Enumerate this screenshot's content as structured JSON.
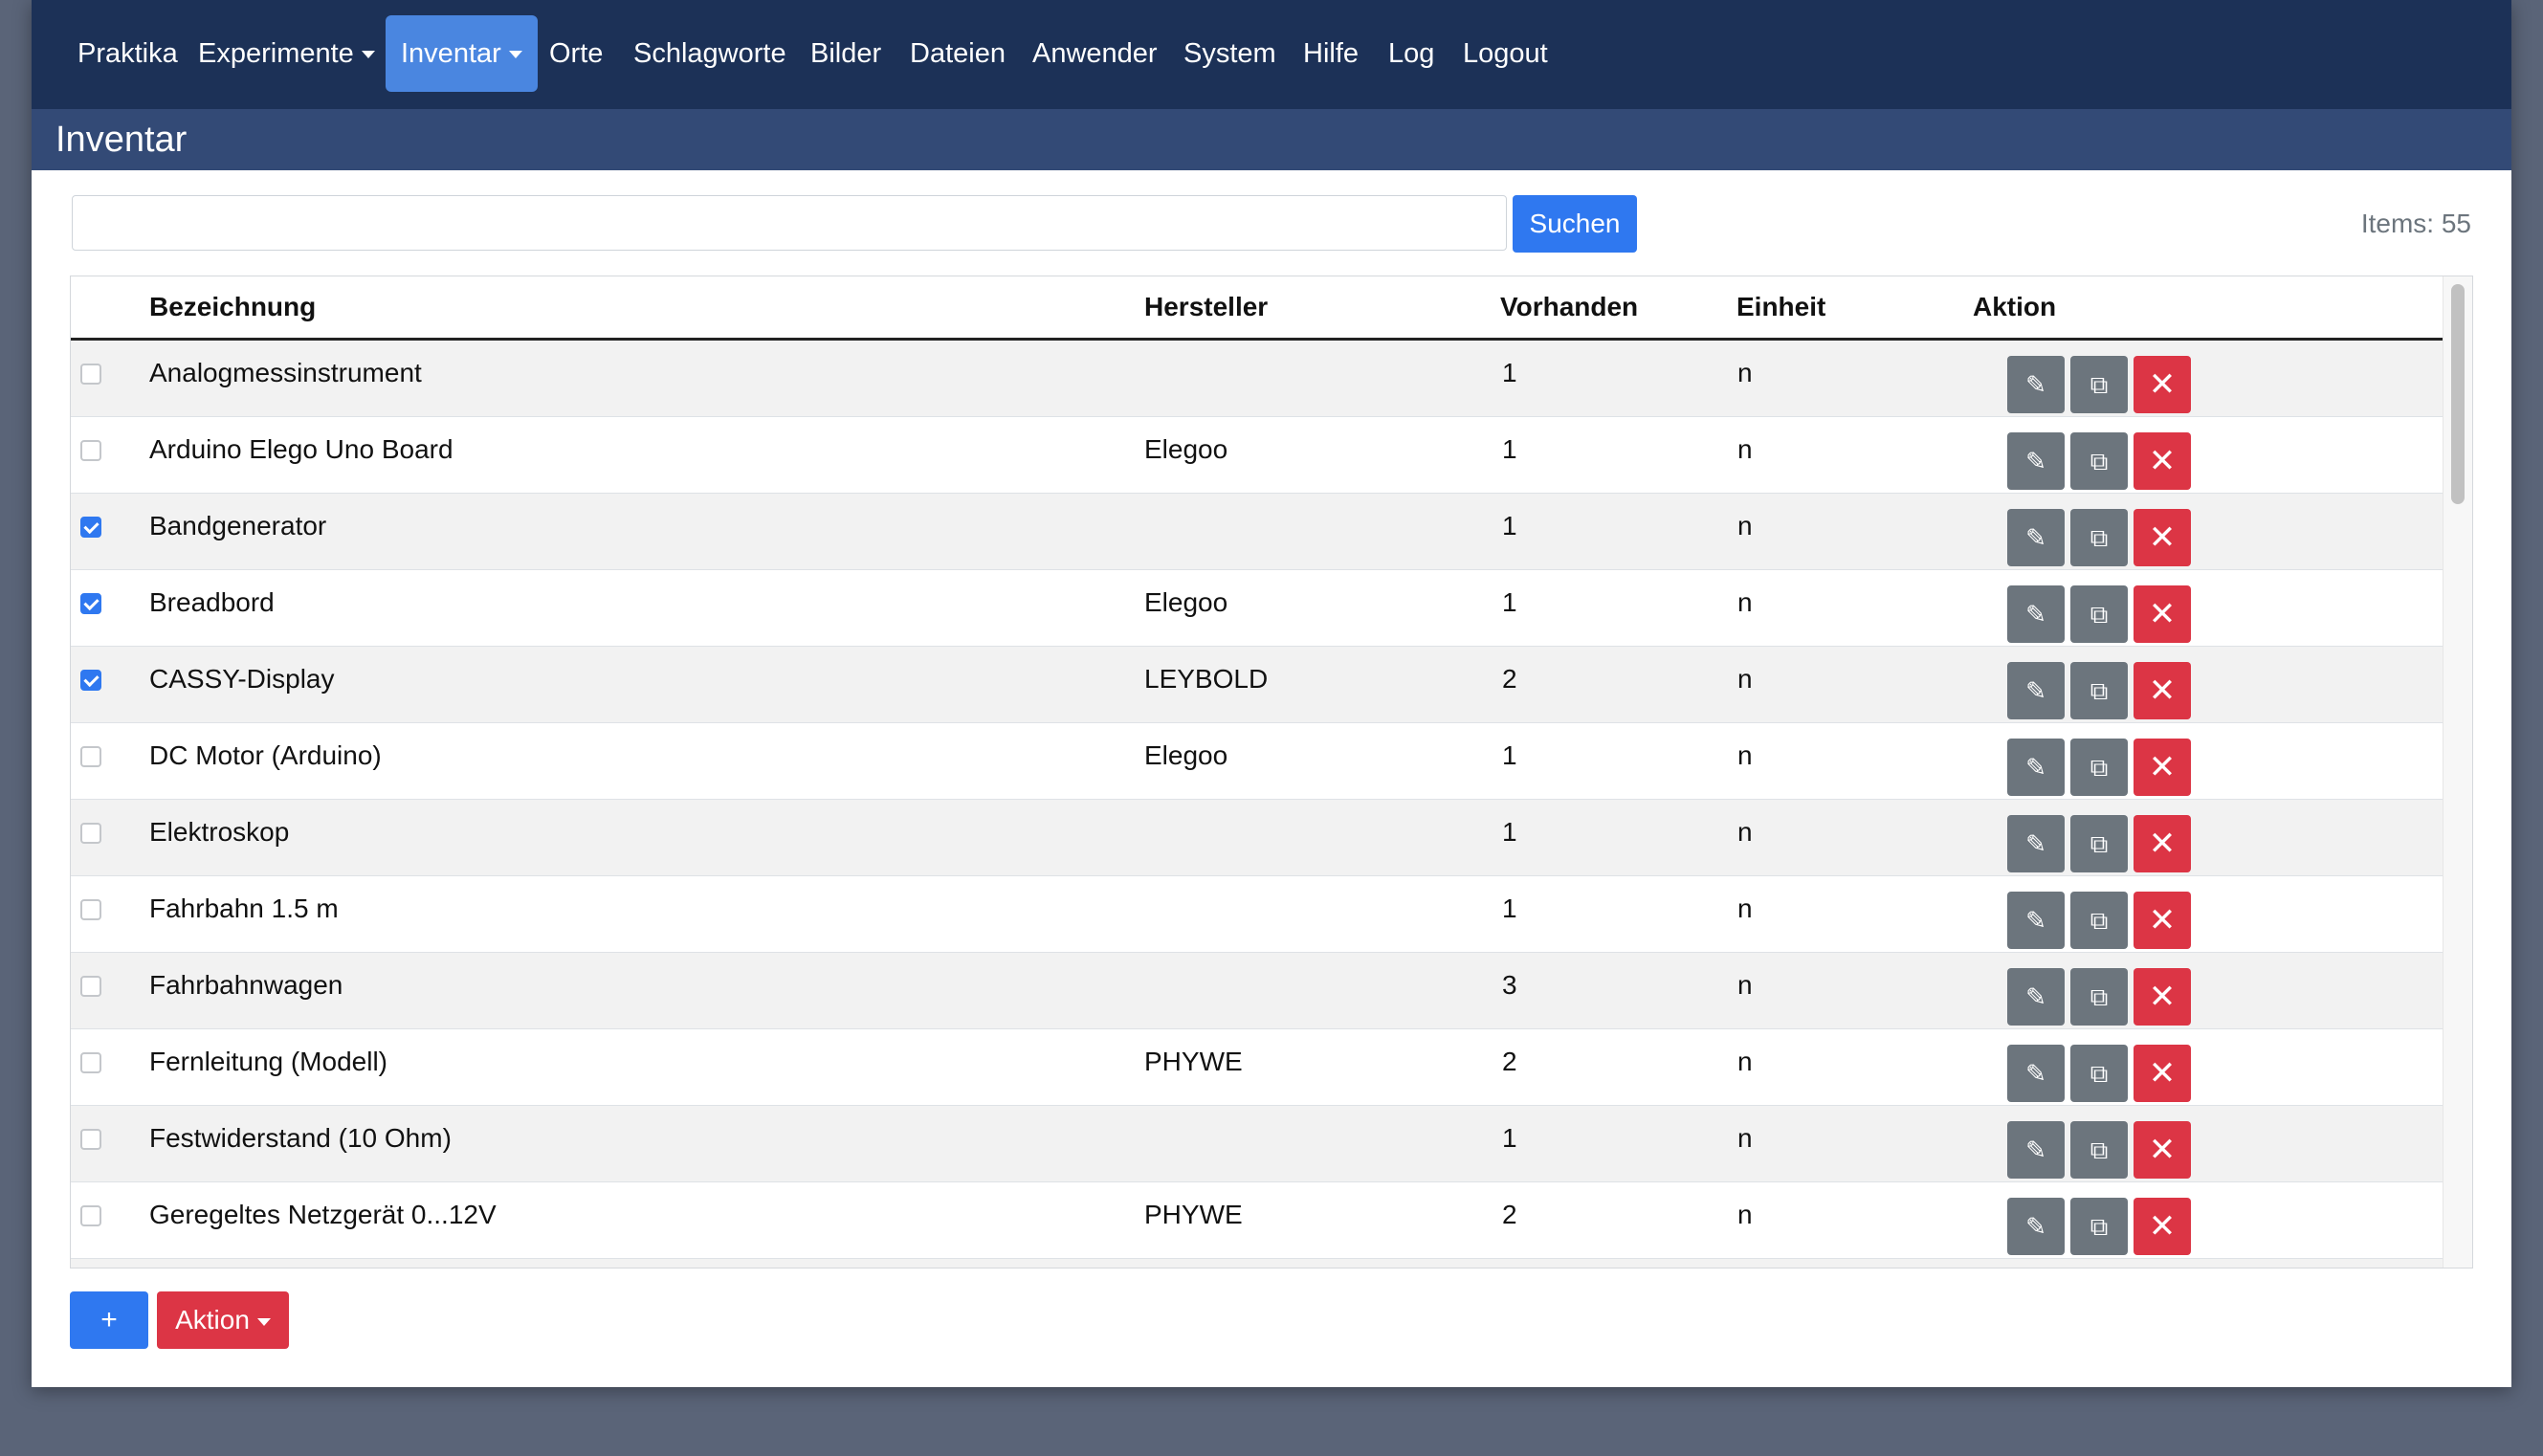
{
  "nav": {
    "items": [
      {
        "label": "Praktika",
        "dropdown": false,
        "active": false
      },
      {
        "label": "Experimente",
        "dropdown": true,
        "active": false
      },
      {
        "label": "Inventar",
        "dropdown": true,
        "active": true
      },
      {
        "label": "Orte",
        "dropdown": false,
        "active": false
      },
      {
        "label": "Schlagworte",
        "dropdown": false,
        "active": false
      },
      {
        "label": "Bilder",
        "dropdown": false,
        "active": false
      },
      {
        "label": "Dateien",
        "dropdown": false,
        "active": false
      },
      {
        "label": "Anwender",
        "dropdown": false,
        "active": false
      },
      {
        "label": "System",
        "dropdown": false,
        "active": false
      },
      {
        "label": "Hilfe",
        "dropdown": false,
        "active": false
      },
      {
        "label": "Log",
        "dropdown": false,
        "active": false
      },
      {
        "label": "Logout",
        "dropdown": false,
        "active": false
      }
    ]
  },
  "page": {
    "title": "Inventar"
  },
  "search": {
    "value": "",
    "placeholder": "",
    "button_label": "Suchen"
  },
  "items_count": "Items: 55",
  "table": {
    "headers": {
      "bezeichnung": "Bezeichnung",
      "hersteller": "Hersteller",
      "vorhanden": "Vorhanden",
      "einheit": "Einheit",
      "aktion": "Aktion"
    },
    "rows": [
      {
        "checked": false,
        "name": "Analogmessinstrument",
        "maker": "",
        "qty": "1",
        "unit": "n"
      },
      {
        "checked": false,
        "name": "Arduino Elego Uno Board",
        "maker": "Elegoo",
        "qty": "1",
        "unit": "n"
      },
      {
        "checked": true,
        "name": "Bandgenerator",
        "maker": "",
        "qty": "1",
        "unit": "n"
      },
      {
        "checked": true,
        "name": "Breadbord",
        "maker": "Elegoo",
        "qty": "1",
        "unit": "n"
      },
      {
        "checked": true,
        "name": "CASSY-Display",
        "maker": "LEYBOLD",
        "qty": "2",
        "unit": "n"
      },
      {
        "checked": false,
        "name": "DC Motor (Arduino)",
        "maker": "Elegoo",
        "qty": "1",
        "unit": "n"
      },
      {
        "checked": false,
        "name": "Elektroskop",
        "maker": "",
        "qty": "1",
        "unit": "n"
      },
      {
        "checked": false,
        "name": "Fahrbahn 1.5 m",
        "maker": "",
        "qty": "1",
        "unit": "n"
      },
      {
        "checked": false,
        "name": "Fahrbahnwagen",
        "maker": "",
        "qty": "3",
        "unit": "n"
      },
      {
        "checked": false,
        "name": "Fernleitung (Modell)",
        "maker": "PHYWE",
        "qty": "2",
        "unit": "n"
      },
      {
        "checked": false,
        "name": "Festwiderstand (10 Ohm)",
        "maker": "",
        "qty": "1",
        "unit": "n"
      },
      {
        "checked": false,
        "name": "Geregeltes Netzgerät 0...12V",
        "maker": "PHYWE",
        "qty": "2",
        "unit": "n"
      }
    ]
  },
  "icons": {
    "edit": "pencil-icon",
    "copy": "copy-icon",
    "delete": "close-icon"
  },
  "colors": {
    "navbar": "#1c3157",
    "titlebar": "#334a76",
    "primary": "#2f78f0",
    "danger": "#dc3545",
    "secondary": "#6c757d"
  },
  "footer": {
    "add_label": "+",
    "action_label": "Aktion"
  }
}
